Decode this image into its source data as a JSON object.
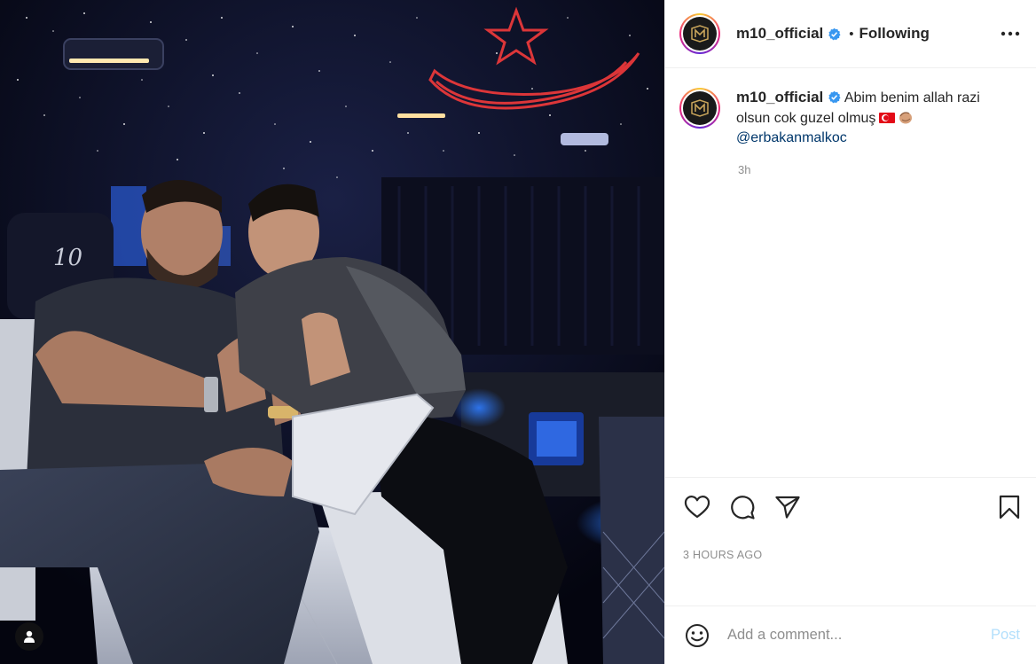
{
  "post": {
    "image_alt": "Two men smiling and giving thumbs up inside a luxury van with a starry ceiling and a red crescent and star light",
    "seat_number": "10"
  },
  "header": {
    "username": "m10_official",
    "separator": "•",
    "follow_state": "Following",
    "more_icon": "more-horizontal-icon"
  },
  "caption": {
    "username": "m10_official",
    "text": "Abim benim allah razi olsun cok guzel olmuş",
    "mention": "@erbakanmalkoc",
    "relative_time": "3h"
  },
  "actions": {
    "like_icon": "heart-icon",
    "comment_icon": "comment-icon",
    "share_icon": "send-icon",
    "save_icon": "bookmark-icon"
  },
  "timestamp": "3 HOURS AGO",
  "comment_box": {
    "emoji_icon": "emoji-icon",
    "placeholder": "Add a comment...",
    "post_label": "Post"
  },
  "colors": {
    "link": "#00376b",
    "muted": "#8e8e8e",
    "post_disabled": "#b2dffc",
    "verified": "#3897f0",
    "flag_red": "#e30a17"
  }
}
